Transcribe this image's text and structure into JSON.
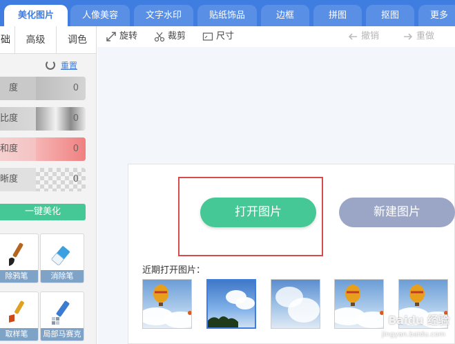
{
  "topbar": {
    "tabs": [
      {
        "label": "美化图片",
        "active": true
      },
      {
        "label": "人像美容"
      },
      {
        "label": "文字水印"
      },
      {
        "label": "贴纸饰品"
      },
      {
        "label": "边框"
      },
      {
        "label": "拼图"
      },
      {
        "label": "抠图"
      },
      {
        "label": "更多"
      }
    ]
  },
  "leftpanel": {
    "subtabs": [
      "础",
      "高级",
      "调色"
    ],
    "reset_label": "重置",
    "sliders": [
      {
        "label": "度",
        "value": "0"
      },
      {
        "label": "比度",
        "value": "0"
      },
      {
        "label": "和度",
        "value": "0"
      },
      {
        "label": "晰度",
        "value": "0"
      }
    ],
    "onekey_label": "一键美化",
    "tools": [
      "除鸦笔",
      "消除笔",
      "取样笔",
      "局部马赛克"
    ]
  },
  "toolbar": {
    "rotate": "旋转",
    "crop": "裁剪",
    "size": "尺寸",
    "undo": "撤销",
    "redo": "重做"
  },
  "welcome": {
    "open_button": "打开图片",
    "new_button": "新建图片",
    "recent_label": "近期打开图片："
  },
  "watermark": {
    "text": "Baidu 经验",
    "sub": "jingyan.baidu.com"
  },
  "colors": {
    "accent": "#3f7ee0",
    "green": "#46c896",
    "new_btn": "#9ba6c7",
    "highlight": "#d84a4a"
  }
}
